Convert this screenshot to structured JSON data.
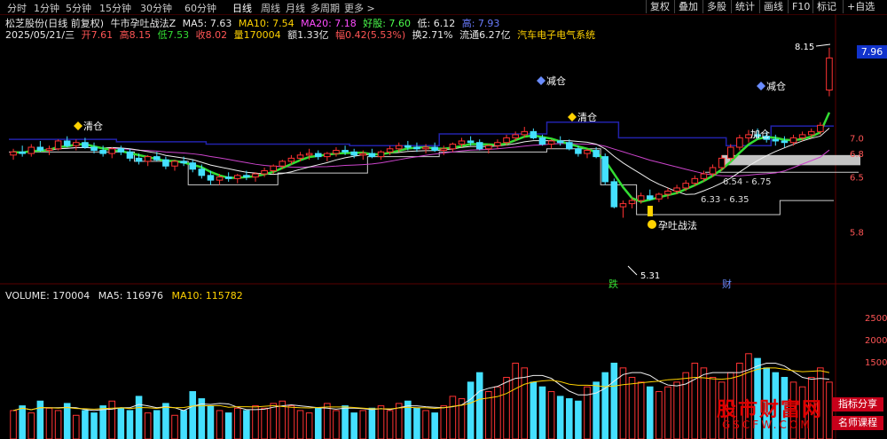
{
  "toolbar": {
    "tabs": [
      "分时",
      "1分钟",
      "5分钟",
      "15分钟",
      "30分钟",
      "60分钟",
      "日线",
      "周线",
      "月线",
      "多周期",
      "更多 >"
    ],
    "active_tab": "日线",
    "right_buttons": [
      "复权",
      "叠加",
      "多股",
      "统计",
      "画线",
      "F10",
      "标记",
      "+自选"
    ]
  },
  "header": {
    "stock_name": "松芝股份(日线 前复权)",
    "indicator_name": "牛市孕吐战法Z",
    "ma5": "MA5: 7.63",
    "ma10": "MA10: 7.54",
    "ma20": "MA20: 7.18",
    "good_stock": "好股: 7.60",
    "low_label": "低: 6.12",
    "high_label": "高: 7.93"
  },
  "quote": {
    "date": "2025/05/21/三",
    "open": "开7.61",
    "high": "高8.15",
    "low": "低7.53",
    "close": "收8.02",
    "volume": "量170004",
    "amount": "额1.33亿",
    "change": "幅0.42(5.53%)",
    "turnover": "换2.71%",
    "float_cap": "流通6.27亿",
    "sector": "汽车电子电气系统"
  },
  "annotations": {
    "qing1": "清仓",
    "jian1": "减仓",
    "qing2": "清仓",
    "jian2": "减仓",
    "jia": "加仓",
    "yuntu": "孕吐战法",
    "high_mark": "8.15",
    "low_mark": "5.31",
    "zone1": "6.54 - 6.75",
    "zone2": "6.33 - 6.35",
    "die": "跌",
    "cai": "财"
  },
  "price_axis": {
    "current": "7.96",
    "labels": [
      "7.0",
      "6.8",
      "6.5",
      "5.8"
    ]
  },
  "volume": {
    "title": "VOLUME: 170004",
    "ma5": "MA5: 116976",
    "ma10": "MA10: 115782",
    "axis": [
      "2500",
      "2000",
      "1500"
    ]
  },
  "watermark": {
    "main": "股市财富网",
    "url": "GSCFW.COM",
    "tag1": "指标分享",
    "tag2": "名师课程"
  },
  "colors": {
    "up": "#ff3333",
    "down": "#44e0ff",
    "ma_green": "#33dd33",
    "ma_white": "#eeeeee",
    "ma_magenta": "#cc44cc",
    "blue_line": "#2222aa",
    "flag": "#ffd200"
  },
  "candles": [
    [
      6.78,
      6.86,
      6.72,
      6.82
    ],
    [
      6.82,
      6.9,
      6.76,
      6.8
    ],
    [
      6.8,
      6.92,
      6.76,
      6.88
    ],
    [
      6.88,
      6.96,
      6.82,
      6.84
    ],
    [
      6.84,
      6.9,
      6.78,
      6.86
    ],
    [
      6.86,
      6.98,
      6.84,
      6.96
    ],
    [
      6.96,
      7.02,
      6.88,
      6.9
    ],
    [
      6.9,
      6.98,
      6.84,
      6.94
    ],
    [
      6.94,
      7.0,
      6.86,
      6.88
    ],
    [
      6.88,
      6.94,
      6.8,
      6.84
    ],
    [
      6.84,
      6.9,
      6.76,
      6.8
    ],
    [
      6.8,
      6.88,
      6.74,
      6.86
    ],
    [
      6.86,
      6.9,
      6.78,
      6.82
    ],
    [
      6.82,
      6.86,
      6.7,
      6.74
    ],
    [
      6.74,
      6.8,
      6.66,
      6.7
    ],
    [
      6.7,
      6.78,
      6.64,
      6.76
    ],
    [
      6.76,
      6.82,
      6.7,
      6.72
    ],
    [
      6.72,
      6.76,
      6.6,
      6.64
    ],
    [
      6.64,
      6.72,
      6.58,
      6.7
    ],
    [
      6.7,
      6.76,
      6.64,
      6.68
    ],
    [
      6.68,
      6.72,
      6.56,
      6.6
    ],
    [
      6.6,
      6.66,
      6.48,
      6.52
    ],
    [
      6.52,
      6.58,
      6.4,
      6.46
    ],
    [
      6.46,
      6.54,
      6.4,
      6.5
    ],
    [
      6.5,
      6.56,
      6.44,
      6.48
    ],
    [
      6.48,
      6.54,
      6.42,
      6.52
    ],
    [
      6.52,
      6.58,
      6.46,
      6.5
    ],
    [
      6.5,
      6.56,
      6.44,
      6.54
    ],
    [
      6.54,
      6.62,
      6.5,
      6.58
    ],
    [
      6.58,
      6.66,
      6.54,
      6.64
    ],
    [
      6.64,
      6.72,
      6.6,
      6.7
    ],
    [
      6.7,
      6.78,
      6.66,
      6.74
    ],
    [
      6.74,
      6.82,
      6.7,
      6.78
    ],
    [
      6.78,
      6.86,
      6.72,
      6.8
    ],
    [
      6.8,
      6.84,
      6.72,
      6.76
    ],
    [
      6.76,
      6.82,
      6.7,
      6.8
    ],
    [
      6.8,
      6.88,
      6.76,
      6.84
    ],
    [
      6.84,
      6.9,
      6.78,
      6.82
    ],
    [
      6.82,
      6.86,
      6.74,
      6.78
    ],
    [
      6.78,
      6.84,
      6.72,
      6.8
    ],
    [
      6.8,
      6.86,
      6.74,
      6.76
    ],
    [
      6.76,
      6.84,
      6.72,
      6.82
    ],
    [
      6.82,
      6.9,
      6.78,
      6.86
    ],
    [
      6.86,
      6.94,
      6.82,
      6.9
    ],
    [
      6.9,
      6.96,
      6.84,
      6.88
    ],
    [
      6.88,
      6.94,
      6.82,
      6.86
    ],
    [
      6.86,
      6.92,
      6.8,
      6.88
    ],
    [
      6.88,
      6.94,
      6.82,
      6.84
    ],
    [
      6.84,
      6.9,
      6.78,
      6.86
    ],
    [
      6.86,
      6.94,
      6.82,
      6.92
    ],
    [
      6.92,
      7.0,
      6.88,
      6.96
    ],
    [
      6.96,
      7.02,
      6.9,
      6.94
    ],
    [
      6.94,
      6.98,
      6.84,
      6.86
    ],
    [
      6.86,
      6.92,
      6.8,
      6.9
    ],
    [
      6.9,
      6.98,
      6.86,
      6.94
    ],
    [
      6.94,
      7.04,
      6.9,
      7.0
    ],
    [
      7.0,
      7.08,
      6.96,
      7.04
    ],
    [
      7.04,
      7.14,
      7.0,
      7.08
    ],
    [
      7.08,
      7.12,
      6.98,
      7.0
    ],
    [
      7.0,
      7.04,
      6.9,
      6.92
    ],
    [
      6.92,
      6.98,
      6.86,
      6.96
    ],
    [
      6.96,
      7.02,
      6.9,
      6.94
    ],
    [
      6.94,
      6.98,
      6.84,
      6.86
    ],
    [
      6.86,
      6.9,
      6.76,
      6.8
    ],
    [
      6.8,
      6.86,
      6.74,
      6.84
    ],
    [
      6.84,
      6.88,
      6.74,
      6.76
    ],
    [
      6.76,
      6.8,
      6.4,
      6.44
    ],
    [
      6.44,
      6.48,
      6.1,
      6.12
    ],
    [
      6.12,
      6.2,
      5.98,
      6.16
    ],
    [
      6.16,
      6.24,
      6.1,
      6.2
    ],
    [
      6.2,
      6.3,
      6.16,
      6.26
    ],
    [
      6.26,
      6.34,
      6.2,
      6.22
    ],
    [
      6.22,
      6.3,
      6.18,
      6.28
    ],
    [
      6.28,
      6.36,
      6.22,
      6.32
    ],
    [
      6.32,
      6.4,
      6.28,
      6.36
    ],
    [
      6.36,
      6.46,
      6.32,
      6.42
    ],
    [
      6.42,
      6.52,
      6.38,
      6.48
    ],
    [
      6.48,
      6.58,
      6.44,
      6.54
    ],
    [
      6.54,
      6.66,
      6.5,
      6.62
    ],
    [
      6.62,
      6.78,
      6.58,
      6.74
    ],
    [
      6.74,
      6.92,
      6.7,
      6.88
    ],
    [
      6.88,
      7.04,
      6.84,
      7.0
    ],
    [
      7.0,
      7.1,
      6.94,
      7.04
    ],
    [
      7.04,
      7.12,
      6.98,
      7.02
    ],
    [
      7.02,
      7.08,
      6.94,
      6.98
    ],
    [
      6.98,
      7.04,
      6.9,
      6.96
    ],
    [
      6.96,
      7.02,
      6.88,
      6.94
    ],
    [
      6.94,
      7.04,
      6.9,
      7.0
    ],
    [
      7.0,
      7.08,
      6.96,
      7.04
    ],
    [
      7.04,
      7.12,
      7.0,
      7.08
    ],
    [
      7.08,
      7.2,
      7.04,
      7.16
    ],
    [
      7.61,
      8.15,
      7.53,
      8.02
    ]
  ],
  "volumes": [
    60,
    70,
    55,
    80,
    65,
    60,
    75,
    50,
    60,
    55,
    70,
    80,
    65,
    60,
    90,
    55,
    60,
    75,
    50,
    60,
    100,
    85,
    70,
    60,
    55,
    65,
    60,
    70,
    65,
    75,
    80,
    70,
    60,
    55,
    65,
    75,
    60,
    70,
    55,
    60,
    65,
    70,
    60,
    75,
    80,
    65,
    60,
    55,
    70,
    90,
    85,
    120,
    140,
    100,
    110,
    130,
    160,
    150,
    120,
    110,
    100,
    90,
    85,
    80,
    110,
    120,
    140,
    160,
    150,
    130,
    120,
    110,
    100,
    110,
    120,
    140,
    160,
    150,
    130,
    120,
    140,
    160,
    180,
    170,
    150,
    140,
    130,
    120,
    110,
    130,
    150,
    120
  ]
}
